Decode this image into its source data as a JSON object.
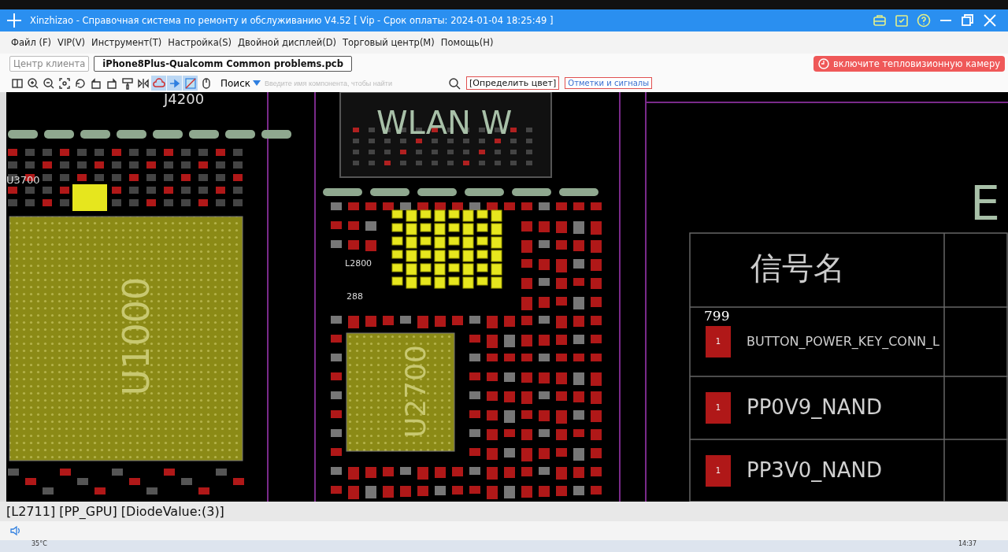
{
  "window": {
    "title": "Xinzhizao - Справочная система по ремонту и обслуживанию V4.52 [ Vip - Срок оплаты: 2024-01-04 18:25:49 ]"
  },
  "menu": [
    "Файл (F)",
    "VIP(V)",
    "Инструмент(T)",
    "Настройка(S)",
    "Двойной дисплей(D)",
    "Торговый центр(M)",
    "Помощь(H)"
  ],
  "tabs": [
    {
      "label": "Центр клиента",
      "selected": false
    },
    {
      "label": "iPhone8Plus-Qualcomm Common problems.pcb",
      "selected": true
    }
  ],
  "camera_button": "включите тепловизионную камеру",
  "toolbar": {
    "tools": [
      {
        "kind": "split",
        "selected": false
      },
      {
        "kind": "zoomin",
        "selected": false
      },
      {
        "kind": "zoomout",
        "selected": false
      },
      {
        "kind": "fit",
        "selected": false
      },
      {
        "kind": "rotate",
        "selected": false
      },
      {
        "kind": "flipleft",
        "selected": false
      },
      {
        "kind": "flipright",
        "selected": false
      },
      {
        "kind": "paint",
        "selected": false
      },
      {
        "kind": "mirror",
        "selected": false
      },
      {
        "kind": "cloud",
        "selected": true
      },
      {
        "kind": "arrow",
        "selected": true
      },
      {
        "kind": "image",
        "selected": true
      },
      {
        "kind": "mouse",
        "selected": false
      }
    ],
    "search_label": "Поиск",
    "search": {
      "placeholder": "Введите имя компонента, чтобы найти"
    },
    "buttons": [
      {
        "label": "[Определить цвет]",
        "kind": "dark"
      },
      {
        "label": "Отметки и сигналы",
        "kind": "link"
      }
    ]
  },
  "board": {
    "labels": [
      {
        "text": "J4200",
        "kind": "small"
      },
      {
        "text": "WLAN W",
        "kind": "large"
      },
      {
        "text": "U3700",
        "kind": "small"
      },
      {
        "text": "L2800",
        "kind": "small"
      },
      {
        "text": "288",
        "kind": "small"
      },
      {
        "text": "U1000",
        "kind": "chip"
      },
      {
        "text": "U2700",
        "kind": "chip"
      },
      {
        "text": "E",
        "kind": "edge"
      }
    ],
    "signal_table": {
      "header": "信号名",
      "rows": [
        {
          "number": "799",
          "pad": "1",
          "name": "BUTTON_POWER_KEY_CONN_L"
        },
        {
          "pad": "1",
          "name": "PP0V9_NAND"
        },
        {
          "pad": "1",
          "name": "PP3V0_NAND"
        }
      ]
    }
  },
  "status_bar": "[L2711] [PP_GPU] [DiodeValue:(3)]",
  "taskbar": {
    "weather": "35°C",
    "time": "14:37"
  }
}
